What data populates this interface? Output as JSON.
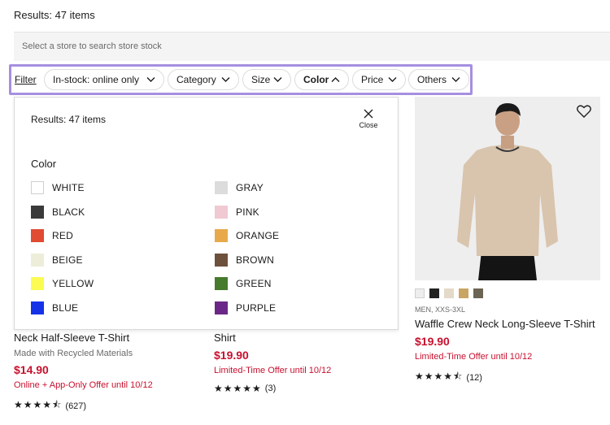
{
  "results_label": "Results: 47 items",
  "store_search": {
    "placeholder": "Select a store to search store stock"
  },
  "filters": {
    "filter_link": "Filter",
    "pills": [
      {
        "label": "In-stock: online only",
        "icon": "chevron-down-icon"
      },
      {
        "label": "Category",
        "icon": "chevron-down-icon"
      },
      {
        "label": "Size",
        "icon": "chevron-down-icon"
      },
      {
        "label": "Color",
        "icon": "chevron-up-icon",
        "active": true
      },
      {
        "label": "Price",
        "icon": "chevron-down-icon"
      },
      {
        "label": "Others",
        "icon": "chevron-down-icon"
      }
    ]
  },
  "color_panel": {
    "results": "Results: 47 items",
    "close_label": "Close",
    "heading": "Color",
    "colors": [
      {
        "name": "WHITE",
        "hex": "#ffffff"
      },
      {
        "name": "GRAY",
        "hex": "#dcdcdc"
      },
      {
        "name": "BLACK",
        "hex": "#3a3a3a"
      },
      {
        "name": "PINK",
        "hex": "#f0c9d2"
      },
      {
        "name": "RED",
        "hex": "#e04b32"
      },
      {
        "name": "ORANGE",
        "hex": "#e8a94a"
      },
      {
        "name": "BEIGE",
        "hex": "#eeedd9"
      },
      {
        "name": "BROWN",
        "hex": "#6e513d"
      },
      {
        "name": "YELLOW",
        "hex": "#fbfb52"
      },
      {
        "name": "GREEN",
        "hex": "#467a2c"
      },
      {
        "name": "BLUE",
        "hex": "#1532e8"
      },
      {
        "name": "PURPLE",
        "hex": "#6b2787"
      }
    ]
  },
  "products": [
    {
      "name": "Neck Half-Sleeve T-Shirt",
      "subtitle": "Made with Recycled Materials",
      "price": "$14.90",
      "offer": "Online + App-Only Offer until 10/12",
      "stars": "★★★★⯪",
      "rating_count": "(627)"
    },
    {
      "name": "Shirt",
      "price": "$19.90",
      "offer": "Limited-Time Offer until 10/12",
      "stars": "★★★★★",
      "rating_count": "(3)"
    },
    {
      "name": "Waffle Crew Neck Long-Sleeve T-Shirt",
      "size_range": "MEN, XXS-3XL",
      "price": "$19.90",
      "offer": "Limited-Time Offer until 10/12",
      "stars": "★★★★⯪",
      "rating_count": "(12)",
      "swatches": [
        "#eeeeee",
        "#222222",
        "#e4dac8",
        "#c9a564",
        "#6b6452"
      ]
    }
  ],
  "colors": {
    "accent_outline": "#a68fe0",
    "price_red": "#c8102e"
  }
}
